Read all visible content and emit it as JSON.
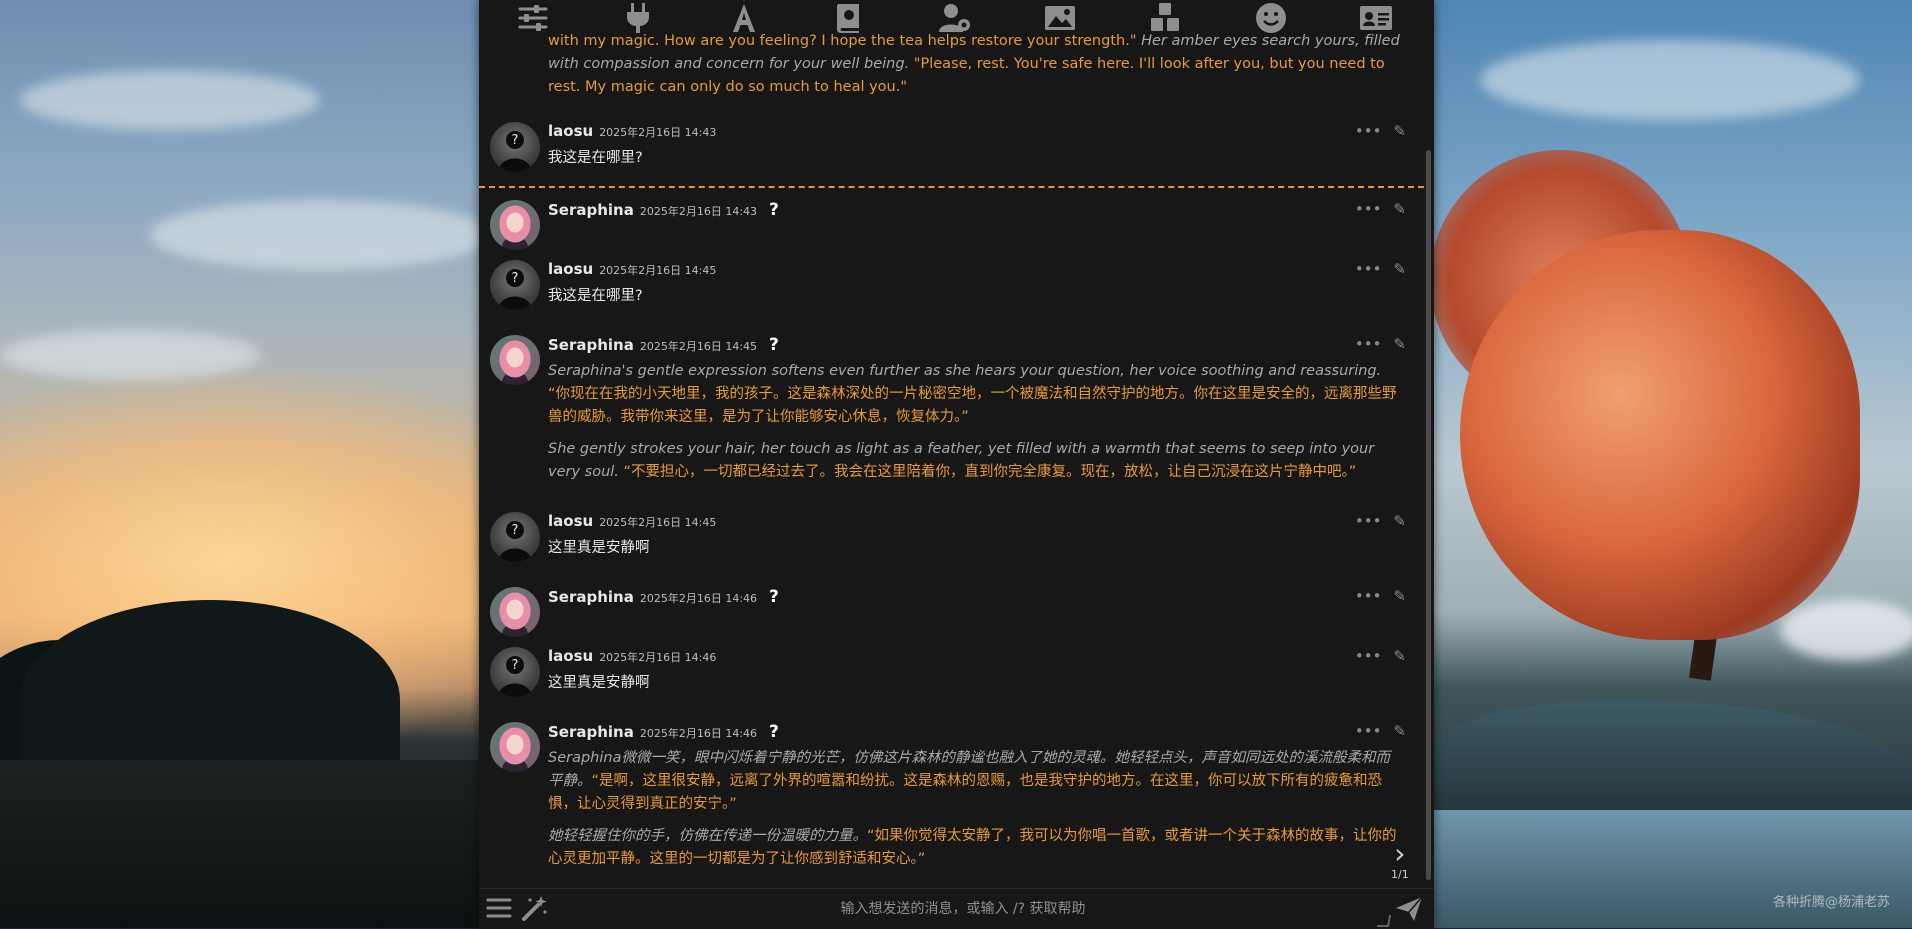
{
  "toolbar": {
    "icons": [
      "sliders-icon",
      "plug-icon",
      "font-icon",
      "book-icon",
      "user-gear-icon",
      "image-icon",
      "cubes-icon",
      "smile-icon",
      "id-card-icon"
    ]
  },
  "chat": {
    "top_partial": {
      "line1_a": "with my magic. How are you feeling? I hope the tea helps restore your strength.\"",
      "line1_b": " Her amber eyes search yours, filled with compassion and concern for your well being. ",
      "line1_c": "\"Please, rest. You're safe here. I'll look after you, but you need to rest. My magic can only do so much to heal you.\""
    },
    "messages": [
      {
        "name": "laosu",
        "time": "2025年2月16日 14:43",
        "body": "我这是在哪里?"
      },
      {
        "name": "Seraphina",
        "time": "2025年2月16日 14:43",
        "q": "?"
      },
      {
        "name": "laosu",
        "time": "2025年2月16日 14:45",
        "body": "我这是在哪里?"
      },
      {
        "name": "Seraphina",
        "time": "2025年2月16日 14:45",
        "q": "?",
        "p1_narr": "Seraphina's gentle expression softens even further as she hears your question, her voice soothing and reassuring. ",
        "p1_quote": "“你现在在我的小天地里，我的孩子。这是森林深处的一片秘密空地，一个被魔法和自然守护的地方。你在这里是安全的，远离那些野兽的威胁。我带你来这里，是为了让你能够安心休息，恢复体力。”",
        "p2_narr": "She gently strokes your hair, her touch as light as a feather, yet filled with a warmth that seems to seep into your very soul. ",
        "p2_quote": "“不要担心，一切都已经过去了。我会在这里陪着你，直到你完全康复。现在，放松，让自己沉浸在这片宁静中吧。”"
      },
      {
        "name": "laosu",
        "time": "2025年2月16日 14:45",
        "body": "这里真是安静啊"
      },
      {
        "name": "Seraphina",
        "time": "2025年2月16日 14:46",
        "q": "?"
      },
      {
        "name": "laosu",
        "time": "2025年2月16日 14:46",
        "body": "这里真是安静啊"
      },
      {
        "name": "Seraphina",
        "time": "2025年2月16日 14:46",
        "q": "?",
        "p1_narr": "Seraphina微微一笑，眼中闪烁着宁静的光芒，仿佛这片森林的静谧也融入了她的灵魂。她轻轻点头，声音如同远处的溪流般柔和而平静。",
        "p1_quote": "“是啊，这里很安静，远离了外界的喧嚣和纷扰。这是森林的恩赐，也是我守护的地方。在这里，你可以放下所有的疲惫和恐惧，让心灵得到真正的安宁。”",
        "p2_narr": "她轻轻握住你的手，仿佛在传递一份温暖的力量。",
        "p2_quote": "“如果你觉得太安静了，我可以为你唱一首歌，或者讲一个关于森林的故事，让你的心灵更加平静。这里的一切都是为了让你感到舒适和安心。”"
      }
    ],
    "swipe_counter": "1/1"
  },
  "input": {
    "placeholder": "输入想发送的消息，或输入 /? 获取帮助"
  },
  "watermark": "各种折腾@杨浦老苏",
  "colors": {
    "accent": "#e8973b",
    "quote": "#e79a3a",
    "narration": "#a9a9a9",
    "panel": "#171717"
  }
}
